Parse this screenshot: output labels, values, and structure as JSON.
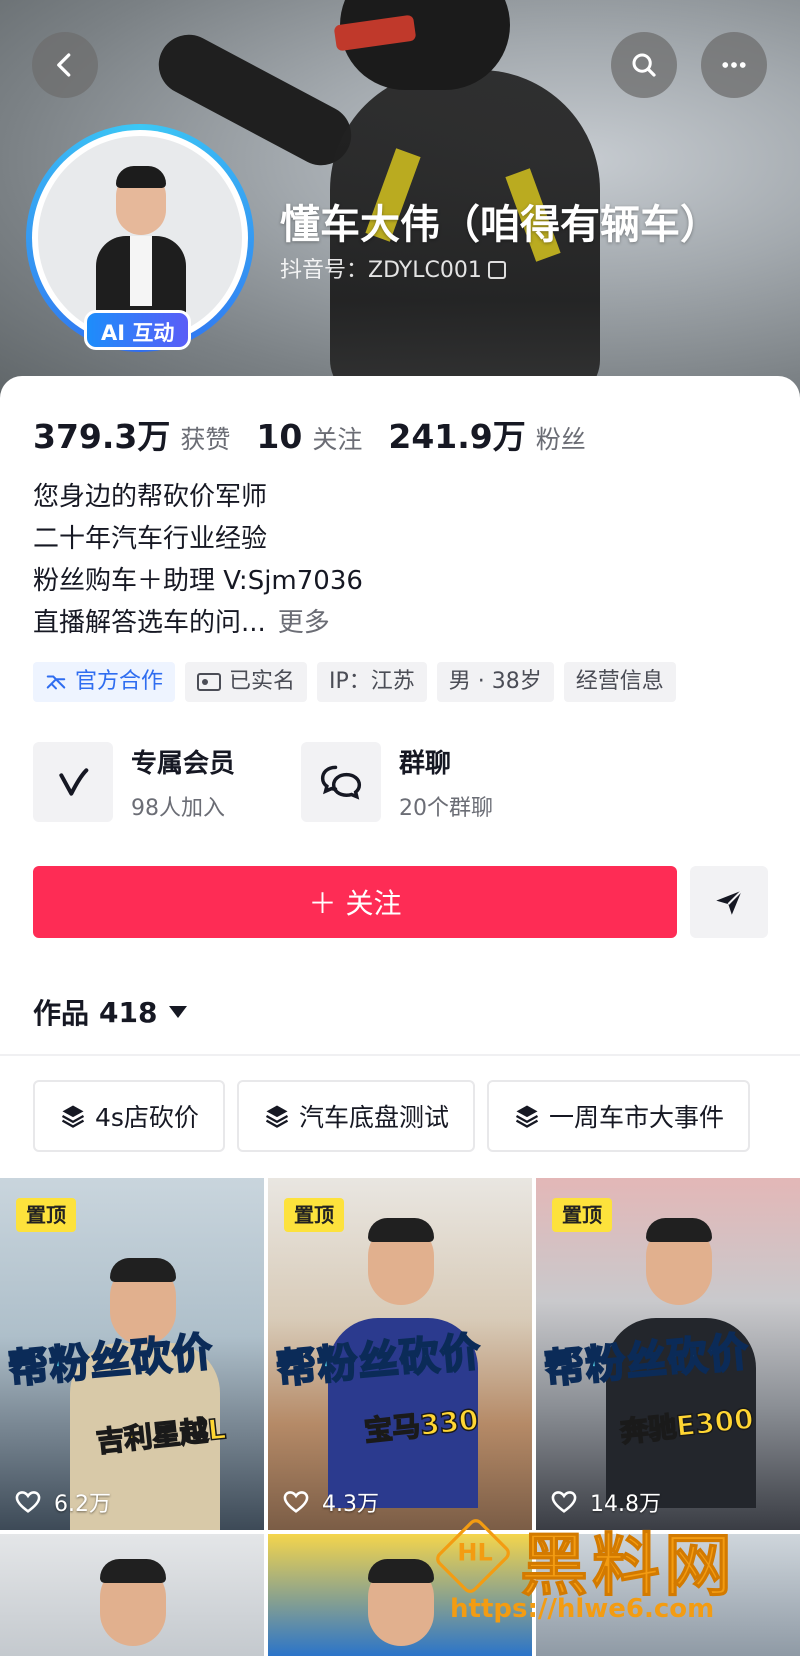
{
  "profile": {
    "nickname": "懂车大伟（咱得有辆车）",
    "douyin_id": "抖音号：ZDYLC001",
    "ai_badge": "AI 互动"
  },
  "stats": [
    {
      "value": "379.3万",
      "label": "获赞"
    },
    {
      "value": "10",
      "label": "关注"
    },
    {
      "value": "241.9万",
      "label": "粉丝"
    }
  ],
  "bio": {
    "lines": [
      "您身边的帮砍价军师",
      "二十年汽车行业经验",
      "粉丝购车＋助理 V:Sjm7036",
      "直播解答选车的问..."
    ],
    "more": "更多"
  },
  "tags": [
    "官方合作",
    "已实名",
    "IP：江苏",
    "男 · 38岁",
    "经营信息"
  ],
  "features": [
    {
      "title": "专属会员",
      "subtitle": "98人加入",
      "icon": "vip-v-icon"
    },
    {
      "title": "群聊",
      "subtitle": "20个群聊",
      "icon": "chat-bubbles-icon"
    }
  ],
  "actions": {
    "follow_label": "＋ 关注",
    "share_icon": "paper-plane-icon"
  },
  "works": {
    "label": "作品",
    "count": "418"
  },
  "collections": [
    "4s店砍价",
    "汽车底盘测试",
    "一周车市大事件"
  ],
  "videos": [
    {
      "pinned": "置顶",
      "headline": "帮粉丝砍价",
      "car": "吉利星越L",
      "likes": "6.2万"
    },
    {
      "pinned": "置顶",
      "headline": "帮粉丝砍价",
      "car": "宝马330",
      "likes": "4.3万"
    },
    {
      "pinned": "置顶",
      "headline": "帮粉丝砍价",
      "car": "奔驰E300",
      "likes": "14.8万"
    }
  ],
  "watermark": {
    "title": "黑料网",
    "url": "https://hlwe6.com",
    "logo_text": "HL"
  },
  "colors": {
    "follow": "#fe2c55",
    "official_blue": "#2f6df0",
    "pinned_yellow": "#fde23c",
    "watermark_orange": "#f39c12"
  }
}
